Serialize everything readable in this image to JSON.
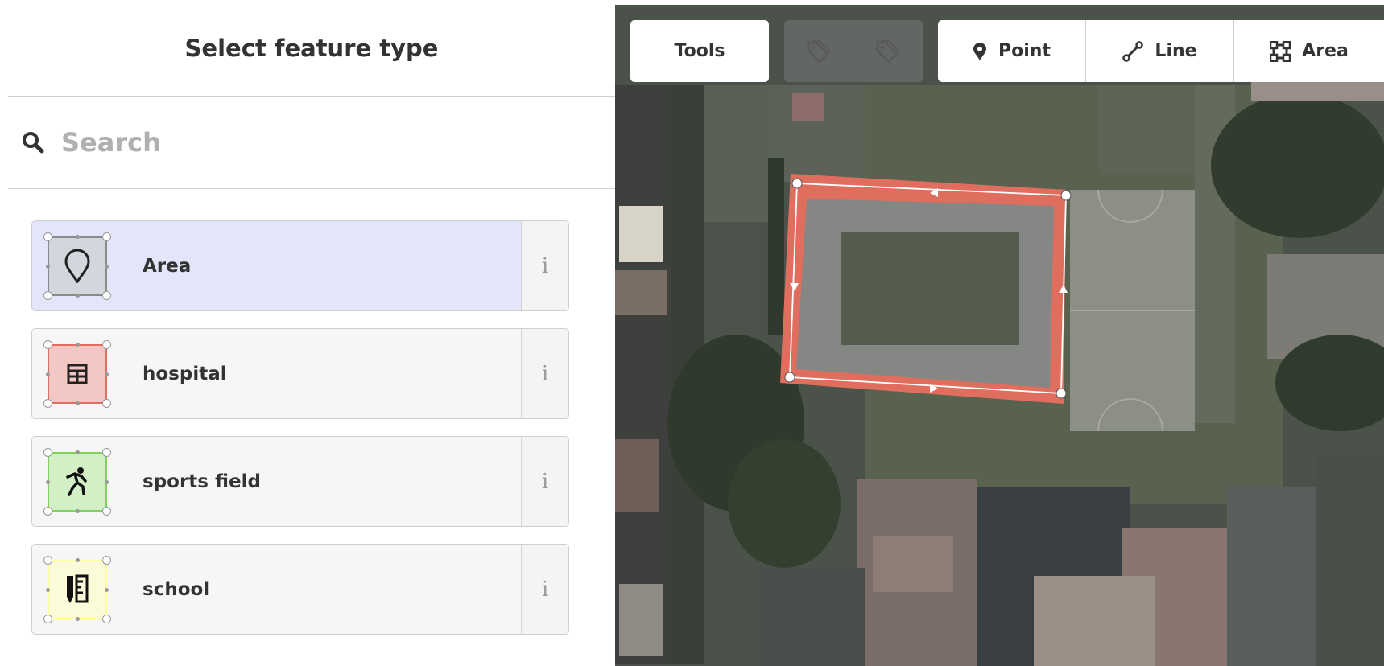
{
  "sidebar": {
    "title": "Select feature type",
    "search": {
      "placeholder": "Search",
      "value": ""
    },
    "presets": [
      {
        "label": "Area",
        "icon": "map-marker-icon",
        "selected": true,
        "color": "#d4d6dd",
        "border": "#8a8a8a",
        "info": "i"
      },
      {
        "label": "hospital",
        "icon": "hospital-building-icon",
        "selected": false,
        "color": "#f3c8c4",
        "border": "#e06e5f",
        "info": "i"
      },
      {
        "label": "sports field",
        "icon": "running-person-icon",
        "selected": false,
        "color": "#d2efc6",
        "border": "#81d25c",
        "info": "i"
      },
      {
        "label": "school",
        "icon": "school-ruler-pencil-icon",
        "selected": false,
        "color": "#fbfbd9",
        "border": "#ffff94",
        "info": "i"
      }
    ]
  },
  "toolbar": {
    "tools_label": "Tools",
    "tag_buttons": [
      "tag-undo-icon",
      "tag-redo-icon"
    ],
    "modes": [
      {
        "label": "Point",
        "icon": "point-marker-icon"
      },
      {
        "label": "Line",
        "icon": "line-icon"
      },
      {
        "label": "Area",
        "icon": "area-icon"
      }
    ]
  },
  "map": {
    "drawn_area_color": "#e06e5f"
  }
}
